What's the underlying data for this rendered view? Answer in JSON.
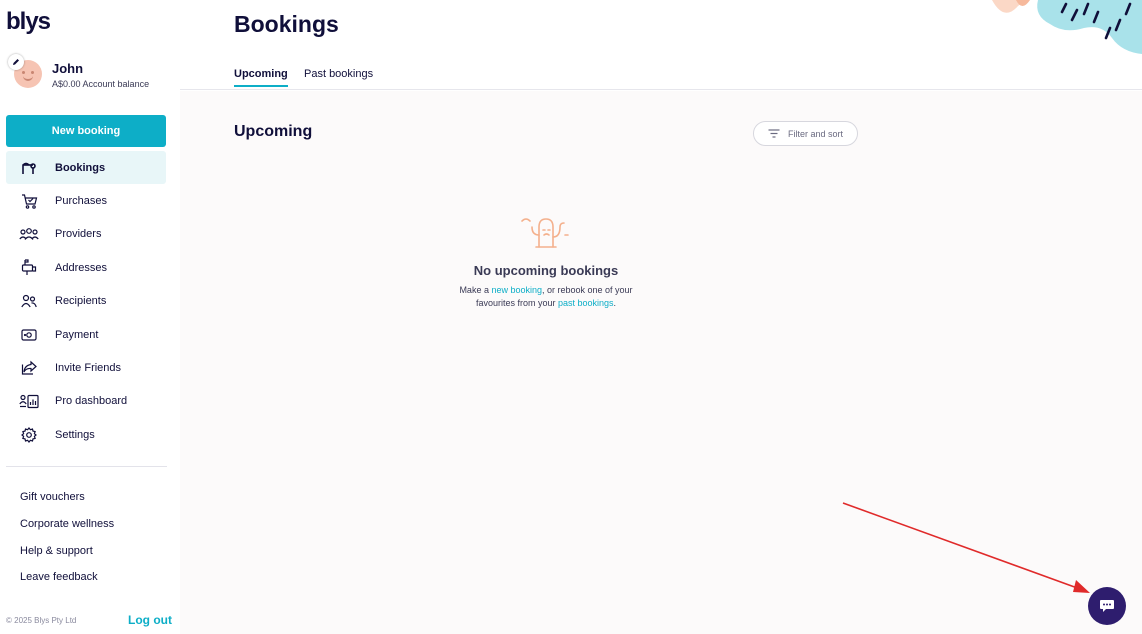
{
  "brand": {
    "logo_text": "blys"
  },
  "profile": {
    "name": "John",
    "balance": "A$0.00 Account balance"
  },
  "sidebar": {
    "new_booking_label": "New booking",
    "items": [
      {
        "label": "Bookings",
        "icon": "bookings-icon",
        "active": true
      },
      {
        "label": "Purchases",
        "icon": "cart-icon"
      },
      {
        "label": "Providers",
        "icon": "providers-icon"
      },
      {
        "label": "Addresses",
        "icon": "mailbox-icon"
      },
      {
        "label": "Recipients",
        "icon": "recipients-icon"
      },
      {
        "label": "Payment",
        "icon": "payment-icon"
      },
      {
        "label": "Invite Friends",
        "icon": "share-icon"
      },
      {
        "label": "Pro dashboard",
        "icon": "pro-dashboard-icon"
      },
      {
        "label": "Settings",
        "icon": "gear-icon"
      }
    ],
    "links": [
      {
        "label": "Gift vouchers"
      },
      {
        "label": "Corporate wellness"
      },
      {
        "label": "Help & support"
      },
      {
        "label": "Leave feedback"
      }
    ],
    "footer": {
      "copyright": "© 2025 Blys Pty Ltd",
      "logout_label": "Log out"
    }
  },
  "header": {
    "title": "Bookings",
    "tabs": [
      {
        "label": "Upcoming",
        "active": true
      },
      {
        "label": "Past bookings"
      }
    ]
  },
  "main": {
    "section_title": "Upcoming",
    "filter_label": "Filter and sort",
    "empty_state": {
      "title": "No upcoming bookings",
      "text_part1": "Make a ",
      "link1": "new booking",
      "text_part2": ", or rebook one of your",
      "text_part3": "favourites from your ",
      "link2": "past bookings",
      "text_part4": "."
    }
  },
  "colors": {
    "brand_dark": "#100f3a",
    "accent_teal": "#0daec7",
    "chat_button": "#2e1d6e",
    "arrow_red": "#e02a2a"
  }
}
